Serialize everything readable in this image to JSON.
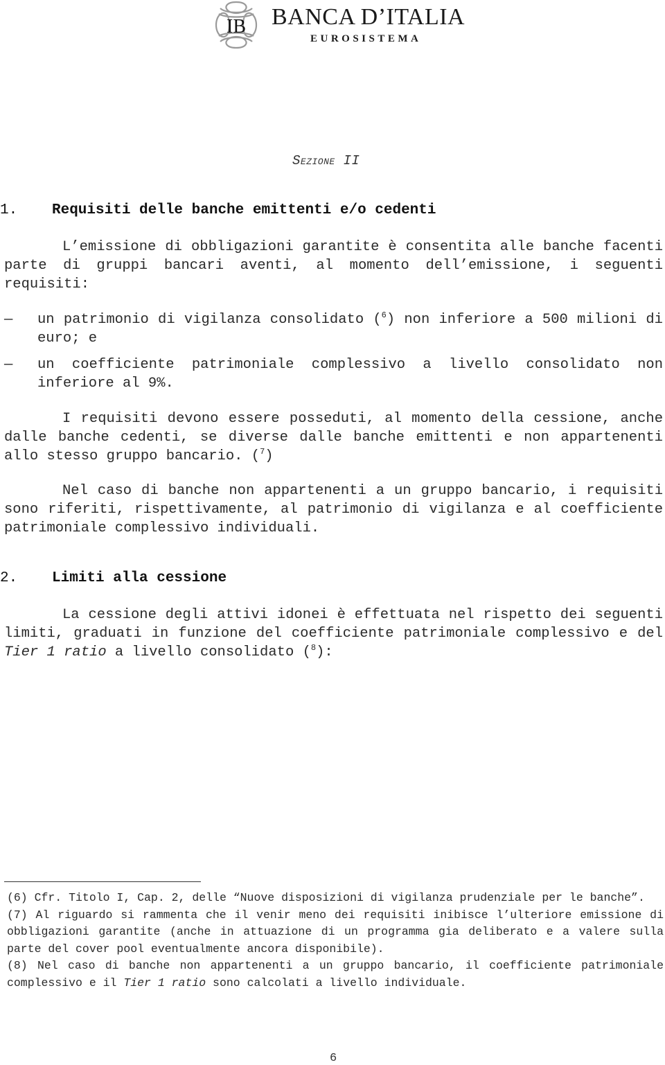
{
  "header": {
    "logo": {
      "icon": "banca-italia-emblem-icon",
      "monogram": "IB",
      "name": "BANCA D’ITALIA",
      "subtitle": "EUROSISTEMA"
    }
  },
  "section_label": "Sezione II",
  "sections": [
    {
      "number": "1.",
      "title": "Requisiti delle banche emittenti e/o cedenti",
      "intro": "L’emissione di obbligazioni garantite è consentita alle banche facenti parte di gruppi bancari aventi, al momento dell’emissione, i seguenti requisiti:",
      "bullets": [
        {
          "dash": "—",
          "text_before": "un patrimonio di vigilanza consolidato (",
          "footnote_ref": "6",
          "text_after": ") non inferiore a 500 milioni di euro; e"
        },
        {
          "dash": "—",
          "text": "un coefficiente patrimoniale complessivo a livello consolidato non inferiore al 9%."
        }
      ],
      "para2_text": "I requisiti devono essere posseduti, al momento della cessione, anche dalle banche cedenti, se diverse dalle banche emittenti e non appartenenti allo stesso gruppo bancario. (",
      "para2_ref": "7",
      "para2_close": ")",
      "para3": "Nel caso di banche non appartenenti a un gruppo bancario, i requisiti sono riferiti, rispettivamente, al patrimonio di vigilanza e al coefficiente patrimoniale complessivo individuali."
    },
    {
      "number": "2.",
      "title": "Limiti alla cessione",
      "para_before": "La cessione degli attivi idonei è effettuata nel rispetto dei seguenti limiti, graduati in funzione del coefficiente patrimoniale complessivo e del ",
      "para_italic": "Tier 1 ratio",
      "para_after": " a livello consolidato (",
      "para_ref": "8",
      "para_close": "):"
    }
  ],
  "footnotes": [
    {
      "text": "(6) Cfr. Titolo I, Cap. 2, delle “Nuove disposizioni di vigilanza prudenziale per le banche”."
    },
    {
      "text": "(7) Al riguardo si rammenta che il venir meno dei requisiti inibisce l’ulteriore emissione di obbligazioni garantite (anche in attuazione di un programma gia deliberato e a valere sulla parte del cover pool eventualmente ancora disponibile)."
    },
    {
      "before": "(8) Nel caso di banche non appartenenti a un gruppo bancario, il coefficiente patrimoniale complessivo e il ",
      "italic": "Tier 1 ratio",
      "after": " sono calcolati a livello individuale."
    }
  ],
  "page_number": "6"
}
